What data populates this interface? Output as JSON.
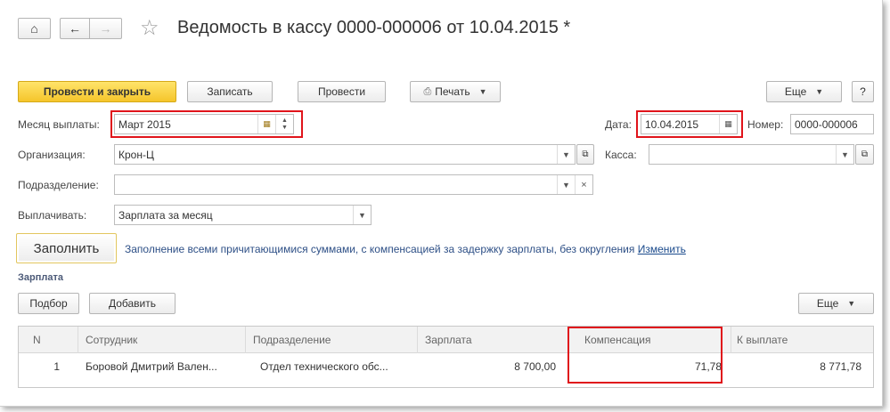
{
  "window": {
    "title": "Ведомость в кассу 0000-000006 от 10.04.2015 *",
    "star_icon": "star-icon"
  },
  "toolbar": {
    "post_close": "Провести и закрыть",
    "save": "Записать",
    "post": "Провести",
    "print": "Печать",
    "more": "Еще",
    "help": "?"
  },
  "form": {
    "month_label": "Месяц выплаты:",
    "month_value": "Март 2015",
    "date_label": "Дата:",
    "date_value": "10.04.2015",
    "number_label": "Номер:",
    "number_value": "0000-000006",
    "org_label": "Организация:",
    "org_value": "Крон-Ц",
    "cash_label": "Касса:",
    "cash_value": "",
    "dept_label": "Подразделение:",
    "dept_value": "",
    "pay_label": "Выплачивать:",
    "pay_value": "Зарплата за месяц"
  },
  "fill": {
    "button": "Заполнить",
    "description": "Заполнение всеми причитающимися суммами, с компенсацией за задержку зарплаты, без округления",
    "change_link": "Изменить"
  },
  "salary": {
    "section_title": "Зарплата",
    "pick_button": "Подбор",
    "add_button": "Добавить",
    "more_button": "Еще",
    "columns": [
      "N",
      "Сотрудник",
      "Подразделение",
      "Зарплата",
      "Компенсация",
      "К выплате"
    ],
    "rows": [
      {
        "n": "1",
        "employee": "Боровой Дмитрий Вален...",
        "department": "Отдел технического обс...",
        "salary": "8 700,00",
        "compensation": "71,78",
        "to_pay": "8 771,78"
      }
    ]
  },
  "colors": {
    "highlight": "#e0141b",
    "primary_button": "#f5c52b",
    "link": "#1a4a8c"
  }
}
